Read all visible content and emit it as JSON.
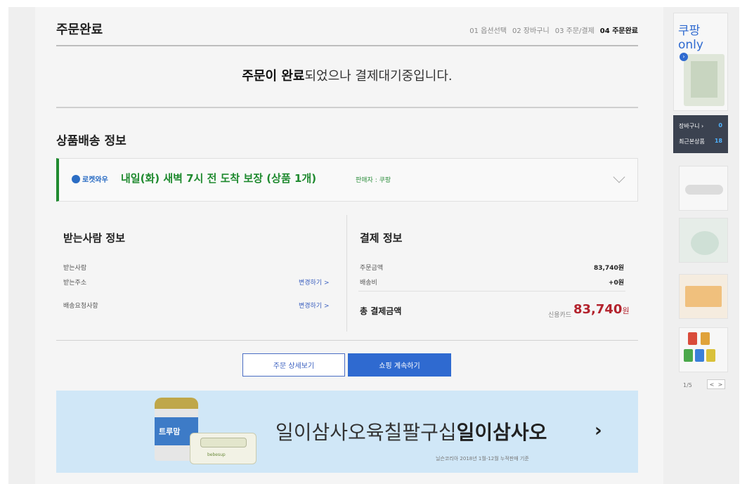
{
  "header": {
    "title": "주문완료",
    "steps": [
      "01 옵션선택",
      "02 장바구니",
      "03 주문/결제",
      "04 주문완료"
    ]
  },
  "message": {
    "part1": "주문이 완료",
    "part2": "되었으나 결제대기중입니다."
  },
  "delivery": {
    "section_title": "상품배송 정보",
    "badge": "로켓와우",
    "text": "내일(화) 새벽 7시 전 도착 보장 (상품 1개)",
    "seller": "판매자 : 쿠팡"
  },
  "receiver": {
    "title": "받는사람 정보",
    "name_label": "받는사람",
    "address_label": "받는주소",
    "request_label": "배송요청사항",
    "change_address": "변경하기 >",
    "change_request": "변경하기 >"
  },
  "payment": {
    "title": "결제 정보",
    "order_amount_label": "주문금액",
    "order_amount": "83,740원",
    "shipping_label": "배송비",
    "shipping": "+0원",
    "total_label": "총 결제금액",
    "total_sub": "신용카드",
    "total_value": "83,740",
    "total_unit": "원"
  },
  "buttons": {
    "detail": "주문 상세보기",
    "continue": "쇼핑 계속하기"
  },
  "banner": {
    "can_label": "트루맘",
    "wipes_label": "bebesup",
    "text_normal": "일이삼사오육칠팔구십",
    "text_bold": "일이삼사오",
    "arrow": "›",
    "note": "닐슨코리아 2018년 1월-12월 누적판매 기준"
  },
  "sidebar": {
    "logo_brand": "쿠팡",
    "logo_suffix": "only",
    "cart_label": "장바구니 ›",
    "cart_count": "0",
    "recent_label": "최근본상품",
    "recent_count": "18",
    "page": "1/5",
    "prev": "<",
    "next": ">"
  },
  "colors": {
    "accent": "#2f6ad0",
    "delivery_green": "#1f8a2f",
    "price_red": "#b3232d"
  }
}
